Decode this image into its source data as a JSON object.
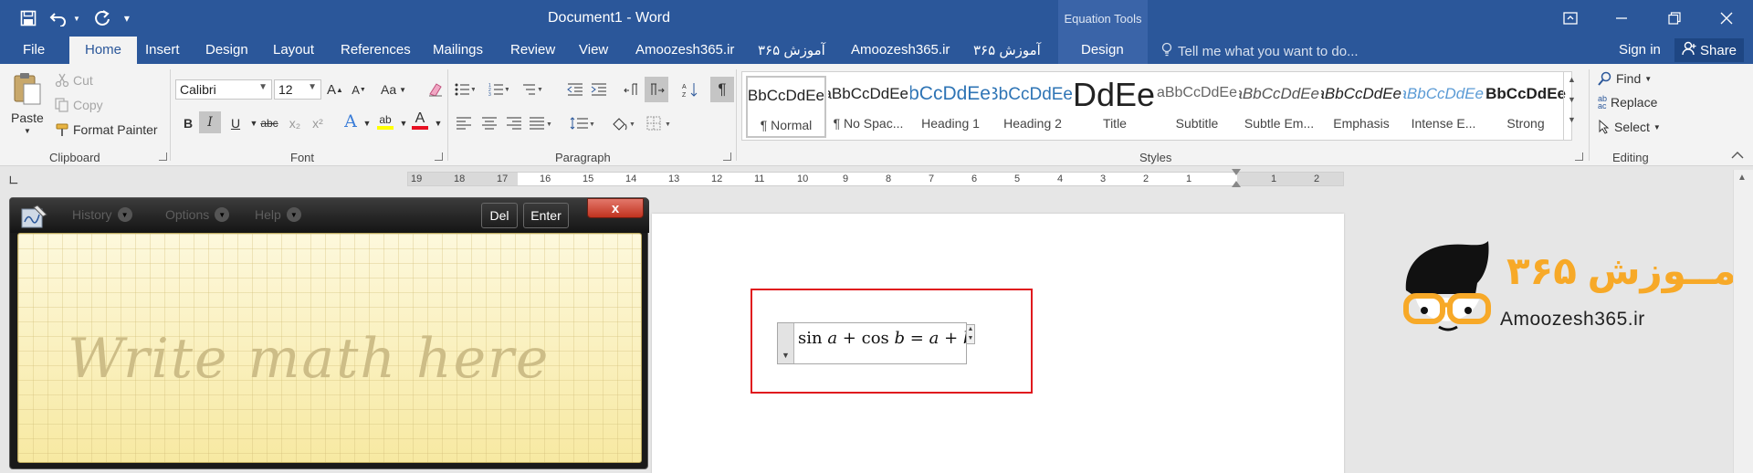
{
  "titlebar": {
    "title": "Document1 - Word",
    "context_group": "Equation Tools",
    "icons": [
      "save-icon",
      "undo-icon",
      "redo-icon",
      "customize-qat-icon",
      "ribbon-display-options-icon",
      "minimize-icon",
      "restore-icon",
      "close-icon"
    ]
  },
  "tabs": {
    "file": "File",
    "home": "Home",
    "insert": "Insert",
    "design": "Design",
    "layout": "Layout",
    "references": "References",
    "mailings": "Mailings",
    "review": "Review",
    "view": "View",
    "amoozesh1": "Amoozesh365.ir",
    "amoozesh1_fa": "آموزش ۳۶۵",
    "amoozesh2": "Amoozesh365.ir",
    "amoozesh2_fa": "آموزش ۳۶۵",
    "eq_design": "Design",
    "tell_me": "Tell me what you want to do...",
    "sign_in": "Sign in",
    "share": "Share"
  },
  "clipboard": {
    "label": "Clipboard",
    "paste": "Paste",
    "cut": "Cut",
    "copy": "Copy",
    "format_painter": "Format Painter"
  },
  "font": {
    "label": "Font",
    "family": "Calibri",
    "size": "12",
    "change_case": "Aa",
    "bold": "B",
    "italic": "I",
    "underline": "U",
    "strikethrough": "abc",
    "subscript": "x₂",
    "superscript": "x²",
    "text_effects": "A",
    "highlight": "ab",
    "font_color": "A",
    "grow": "A",
    "shrink": "A",
    "colors": {
      "highlight": "#ffff00",
      "font_color": "#e81123"
    }
  },
  "paragraph": {
    "label": "Paragraph"
  },
  "styles": {
    "label": "Styles",
    "items": [
      {
        "preview": "AaBbCcDdEe",
        "name": "¶ Normal"
      },
      {
        "preview": "AaBbCcDdEe",
        "name": "¶ No Spac..."
      },
      {
        "preview": "AaBbCcDdEe",
        "name": "Heading 1"
      },
      {
        "preview": "AaBbCcDdEe",
        "name": "Heading 2"
      },
      {
        "preview": "AaBbCcDdEe",
        "name": "Title"
      },
      {
        "preview": "AaBbCcDdEe",
        "name": "Subtitle"
      },
      {
        "preview": "AaBbCcDdEe",
        "name": "Subtle Em..."
      },
      {
        "preview": "AaBbCcDdEe",
        "name": "Emphasis"
      },
      {
        "preview": "AaBbCcDdEe",
        "name": "Intense E..."
      },
      {
        "preview": "AaBbCcDdEe",
        "name": "Strong"
      }
    ]
  },
  "editing": {
    "label": "Editing",
    "find": "Find",
    "replace": "Replace",
    "select": "Select"
  },
  "ruler": {
    "numbers": [
      "19",
      "18",
      "17",
      "16",
      "15",
      "14",
      "13",
      "12",
      "11",
      "10",
      "9",
      "8",
      "7",
      "6",
      "5",
      "4",
      "3",
      "2",
      "1",
      "1",
      "2"
    ]
  },
  "equation": {
    "text_parts": [
      "sin",
      "a",
      "+",
      "cos",
      "b",
      "=",
      "a",
      "+",
      "b"
    ]
  },
  "math_panel": {
    "menu_history": "History",
    "menu_options": "Options",
    "menu_help": "Help",
    "del": "Del",
    "enter": "Enter",
    "close": "x",
    "hint": "Write math here"
  },
  "logo": {
    "brand_fa": "آمــوزش ۳۶۵",
    "site": "Amoozesh365.ir",
    "colors": {
      "orange": "#f7a928",
      "dark": "#111111"
    }
  },
  "theme": {
    "word_blue": "#2b579a",
    "highlight_red": "#e0191e"
  }
}
